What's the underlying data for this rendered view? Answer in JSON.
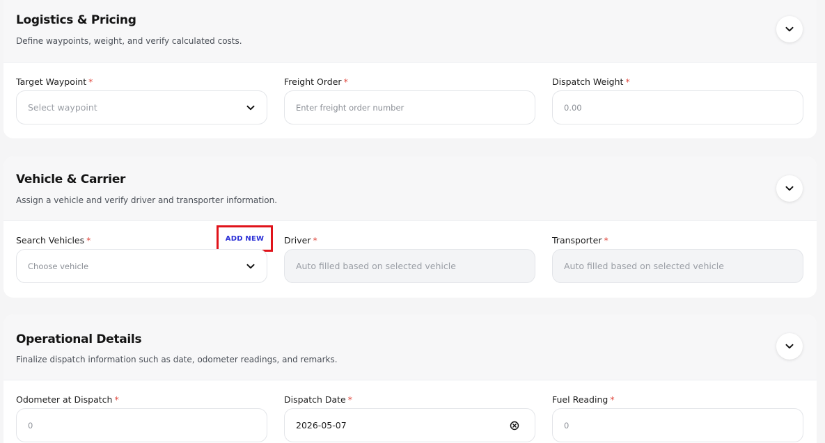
{
  "sections": [
    {
      "title": "Logistics & Pricing",
      "subtitle": "Define waypoints, weight, and verify calculated costs.",
      "fields": [
        {
          "label": "Target Waypoint",
          "placeholder": "Select waypoint",
          "type": "select"
        },
        {
          "label": "Freight Order",
          "placeholder": "Enter freight order number",
          "type": "text"
        },
        {
          "label": "Dispatch Weight",
          "placeholder": "0.00",
          "type": "number"
        }
      ]
    },
    {
      "title": "Vehicle & Carrier",
      "subtitle": "Assign a vehicle and verify driver and transporter information.",
      "add_new_label": "ADD NEW",
      "fields": [
        {
          "label": "Search Vehicles",
          "placeholder": "Choose vehicle",
          "type": "select"
        },
        {
          "label": "Driver",
          "placeholder": "Auto filled based on selected vehicle",
          "type": "readonly"
        },
        {
          "label": "Transporter",
          "placeholder": "Auto filled based on selected vehicle",
          "type": "readonly"
        }
      ]
    },
    {
      "title": "Operational Details",
      "subtitle": "Finalize dispatch information such as date, odometer readings, and remarks.",
      "fields": [
        {
          "label": "Odometer at Dispatch",
          "placeholder": "0",
          "type": "number"
        },
        {
          "label": "Dispatch Date",
          "value": "2026-05-07",
          "type": "date"
        },
        {
          "label": "Fuel Reading",
          "placeholder": "0",
          "type": "number"
        }
      ]
    }
  ],
  "required_marker": "*",
  "icons": {
    "toggle": "chevron-down-icon",
    "select": "chevron-down-icon",
    "date_clear": "clear-circle-icon"
  },
  "colors": {
    "required": "#e0483e",
    "add_new_text": "#2a2fd6",
    "highlight_border": "#e0131a"
  }
}
